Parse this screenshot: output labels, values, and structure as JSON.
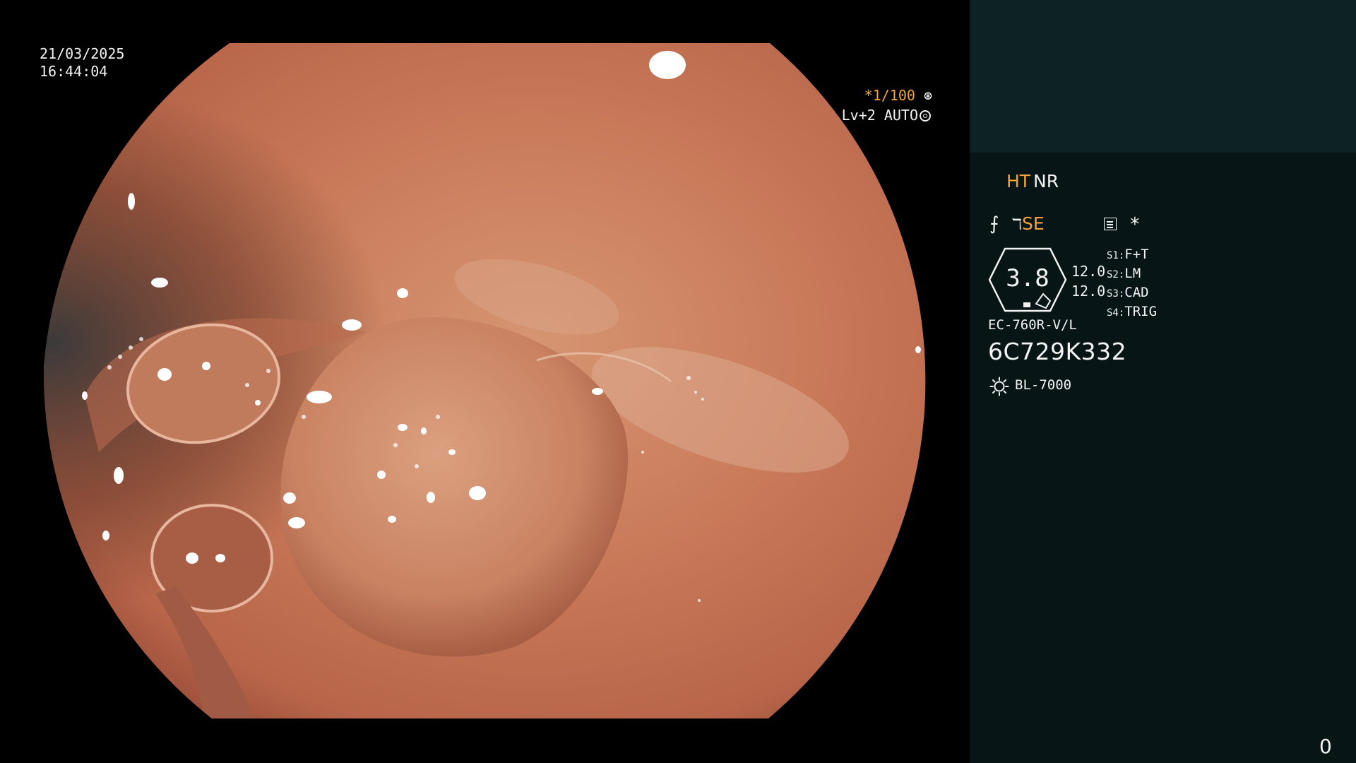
{
  "overlay": {
    "date": "21/03/2025",
    "time": "16:44:04",
    "shutter": "*1/100",
    "level": "Lv+2 AUTO"
  },
  "panel": {
    "ht": "HT",
    "nr": "NR",
    "se": "SE",
    "star": "*",
    "gauge_value": "3.8",
    "value_1": "12.0",
    "value_2": "12.0",
    "s1_key": "S1:",
    "s1": "F+T",
    "s2_key": "S2:",
    "s2": "LM",
    "s3_key": "S3:",
    "s3": "CAD",
    "s4_key": "S4:",
    "s4": "TRIG",
    "model": "EC-760R-V/L",
    "serial": "6C729K332",
    "lamp": "BL-7000",
    "counter": "0"
  },
  "colors": {
    "orange_text": "#f2a43a",
    "panel_bg": "#081516",
    "panel_top_bg": "#0d2224"
  },
  "icons": [
    "aperture-icon",
    "ring-icon",
    "scope-icon",
    "f-icon",
    "menu-icon",
    "lamp-icon"
  ]
}
